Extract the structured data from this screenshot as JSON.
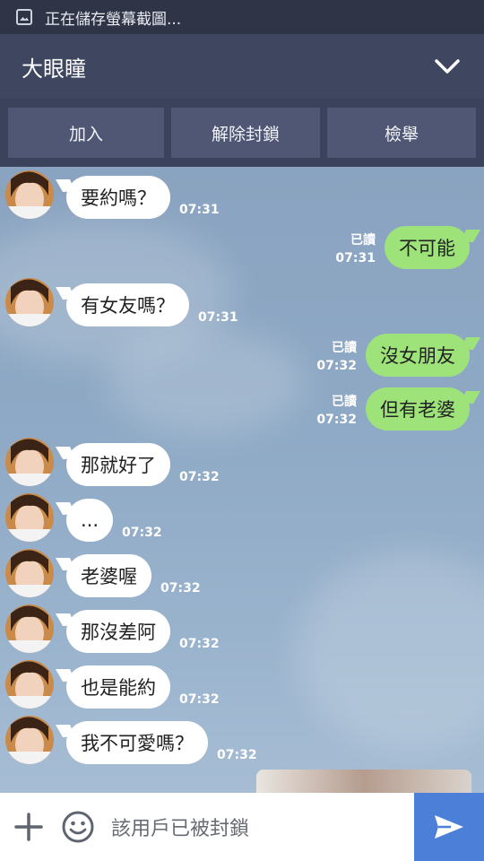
{
  "status_bar": {
    "text": "正在儲存螢幕截圖..."
  },
  "header": {
    "title": "大眼瞳"
  },
  "actions": {
    "add": "加入",
    "unblock": "解除封鎖",
    "report": "檢舉"
  },
  "messages": [
    {
      "side": "in",
      "text": "要約嗎？",
      "time": "07:31"
    },
    {
      "side": "out",
      "text": "不可能",
      "read": "已讀",
      "time": "07:31"
    },
    {
      "side": "in",
      "text": "有女友嗎？",
      "time": "07:31"
    },
    {
      "side": "out",
      "text": "沒女朋友",
      "read": "已讀",
      "time": "07:32"
    },
    {
      "side": "out",
      "text": "但有老婆",
      "read": "已讀",
      "time": "07:32"
    },
    {
      "side": "in",
      "text": "那就好了",
      "time": "07:32"
    },
    {
      "side": "in",
      "text": "...",
      "time": "07:32"
    },
    {
      "side": "in",
      "text": "老婆喔",
      "time": "07:32"
    },
    {
      "side": "in",
      "text": "那沒差阿",
      "time": "07:32"
    },
    {
      "side": "in",
      "text": "也是能約",
      "time": "07:32"
    },
    {
      "side": "in",
      "text": "我不可愛嗎？",
      "time": "07:32"
    }
  ],
  "input": {
    "placeholder": "該用戶已被封鎖"
  },
  "icons": {
    "status": "image-icon",
    "header": "chevron-down-icon",
    "attach": "plus-icon",
    "sticker": "emoji-icon",
    "send": "send-icon"
  },
  "colors": {
    "header": "#3f4660",
    "status_bar": "#2f3447",
    "outgoing_bubble": "#9de37a",
    "incoming_bubble": "#ffffff",
    "send_button": "#4c80d8"
  }
}
